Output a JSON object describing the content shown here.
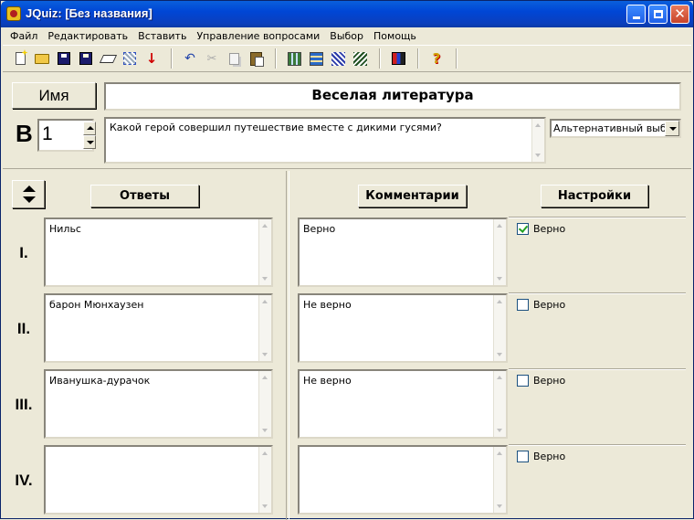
{
  "window": {
    "title": "JQuiz: [Без названия]"
  },
  "menu": [
    {
      "label": "Файл"
    },
    {
      "label": "Редактировать"
    },
    {
      "label": "Вставить"
    },
    {
      "label": "Управление вопросами"
    },
    {
      "label": "Выбор"
    },
    {
      "label": "Помощь"
    }
  ],
  "toolbar": {
    "icons": [
      "new-file-icon",
      "open-folder-icon",
      "save-icon",
      "save-as-icon",
      "eraser-icon",
      "web-export-icon",
      "down-arrow-icon",
      "undo-icon",
      "cut-icon",
      "copy-icon",
      "paste-icon",
      "grid-icon",
      "grid-alt-icon",
      "grid-export-icon",
      "grid-export-alt-icon",
      "palette-icon",
      "help-icon"
    ]
  },
  "header": {
    "name_button": "Имя",
    "quiz_title": "Веселая литература",
    "question_letter": "В",
    "question_number": "1",
    "question_text": "Какой герой совершил путешествие вместе с дикими гусями?",
    "question_type": "Альтернативный выбор"
  },
  "columns": {
    "answers": "Ответы",
    "comments": "Комментарии",
    "settings": "Настройки"
  },
  "rows": [
    {
      "label": "I.",
      "answer": "Нильс",
      "comment": "Верно",
      "setting_label": "Верно",
      "checked": true
    },
    {
      "label": "II.",
      "answer": "барон Мюнхаузен",
      "comment": "Не верно",
      "setting_label": "Верно",
      "checked": false
    },
    {
      "label": "III.",
      "answer": "Иванушка-дурачок",
      "comment": "Не верно",
      "setting_label": "Верно",
      "checked": false
    },
    {
      "label": "IV.",
      "answer": "",
      "comment": "",
      "setting_label": "Верно",
      "checked": false
    }
  ]
}
